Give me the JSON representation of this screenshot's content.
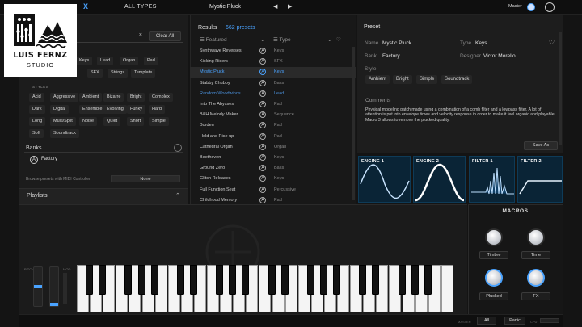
{
  "topbar": {
    "close_glyph": "X",
    "types": "ALL TYPES",
    "preset_name": "Mystic Pluck",
    "prev_glyph": "◀",
    "next_glyph": "▶",
    "master_label": "Master"
  },
  "logo": {
    "line1": "LUIS FERNZ",
    "line2": "STUDIO"
  },
  "search": {
    "clear_glyph": "×",
    "clear_all": "Clear All"
  },
  "type_chips": [
    "Keys",
    "Lead",
    "Organ",
    "Pad"
  ],
  "type_chips_row2": [
    "SFX",
    "Strings",
    "Template"
  ],
  "styles_label": "STYLES",
  "styles": [
    [
      "Acid",
      "Aggressive",
      "Ambient",
      "Bizarre",
      "Bright",
      "Complex"
    ],
    [
      "Dark",
      "Digital",
      "Ensemble",
      "Evolving",
      "Funky",
      "Hard"
    ],
    [
      "Long",
      "Multi/Split",
      "Noise",
      "Quiet",
      "Short",
      "Simple"
    ],
    [
      "Soft",
      "Soundtrack"
    ]
  ],
  "banks": {
    "label": "Banks",
    "factory_glyph": "A",
    "factory": "Factory"
  },
  "browse": {
    "label": "Browse presets with MIDI Controller",
    "value": "None"
  },
  "playlists": {
    "label": "Playlists",
    "caret": "⌃"
  },
  "results": {
    "title": "Results",
    "count": "662 presets",
    "col_featured": "☰ Featured",
    "col_type": "☰ Type",
    "sort_glyph": "⌄",
    "rows": [
      {
        "name": "Synthwave Reverses",
        "type": "Keys"
      },
      {
        "name": "Kicking Risers",
        "type": "SFX"
      },
      {
        "name": "Mystic Pluck",
        "type": "Keys"
      },
      {
        "name": "Stabby Chubby",
        "type": "Bass"
      },
      {
        "name": "Random Woodwinds",
        "type": "Lead"
      },
      {
        "name": "Into The Abysses",
        "type": "Pad"
      },
      {
        "name": "B&H Melody Maker",
        "type": "Sequence"
      },
      {
        "name": "Borden",
        "type": "Pad"
      },
      {
        "name": "Hold and Rise up",
        "type": "Pad"
      },
      {
        "name": "Cathedral Organ",
        "type": "Organ"
      },
      {
        "name": "Beethoven",
        "type": "Keys"
      },
      {
        "name": "Ground Zero",
        "type": "Bass"
      },
      {
        "name": "Glitch Releases",
        "type": "Keys"
      },
      {
        "name": "Full Function Seat",
        "type": "Percussive"
      },
      {
        "name": "Childhood Memory",
        "type": "Pad"
      }
    ],
    "row_icon_glyph": "A"
  },
  "preset": {
    "header": "Preset",
    "name_label": "Name",
    "name_value": "Mystic Pluck",
    "type_label": "Type",
    "type_value": "Keys",
    "bank_label": "Bank",
    "bank_value": "Factory",
    "designer_label": "Designer",
    "designer_value": "Victor Morello",
    "style_label": "Style",
    "style_tags": [
      "Ambient",
      "Bright",
      "Simple",
      "Soundtrack"
    ],
    "comments_label": "Comments",
    "comments": "Physical modeling patch made using a combination of a comb filter and a lowpass filter. A lot of attention is put into envelope times and velocity response in order to make it feel organic and playable. Macro 3 allows to remove the plucked quality.",
    "save_as": "Save As",
    "heart_glyph": "♡"
  },
  "engines": [
    {
      "label": "ENGINE 1"
    },
    {
      "label": "ENGINE 2"
    },
    {
      "label": "FILTER 1"
    },
    {
      "label": "FILTER 2"
    }
  ],
  "wheels": {
    "pitch_label": "PITCH",
    "mod_label": "MOD"
  },
  "macros": {
    "title": "MACROS",
    "items": [
      {
        "label": "Timbre"
      },
      {
        "label": "Time"
      },
      {
        "label": "Plucked"
      },
      {
        "label": "FX"
      }
    ]
  },
  "status": {
    "master_label": "MASTER",
    "all": "All",
    "panic": "Panic",
    "cpu_label": "CPU"
  },
  "colors": {
    "accent": "#4aa3ff",
    "background": "#141414",
    "panel": "#1c1c1c"
  }
}
